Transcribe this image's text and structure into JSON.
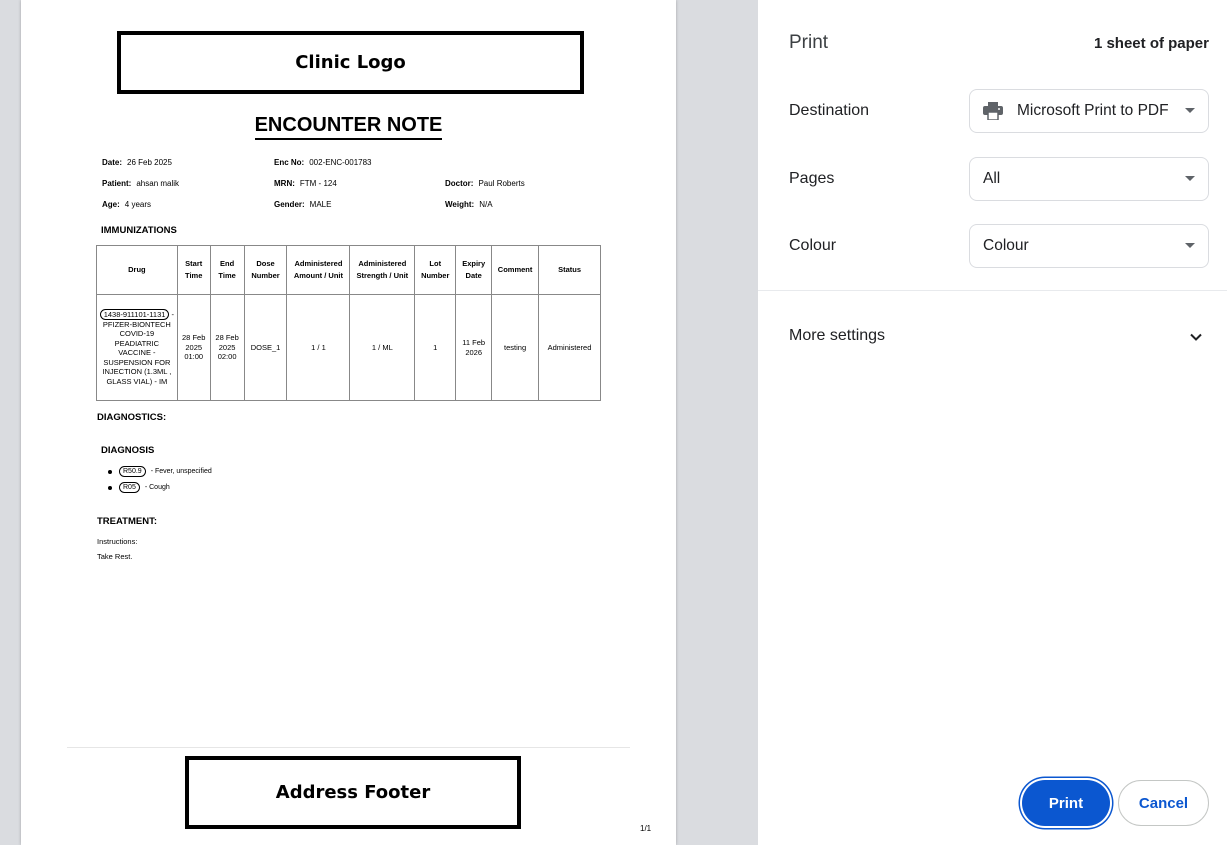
{
  "document": {
    "logo_text": "Clinic Logo",
    "title": "ENCOUNTER NOTE",
    "fields": {
      "date_label": "Date:",
      "date_value": "26 Feb 2025",
      "enc_label": "Enc No:",
      "enc_value": "002-ENC-001783",
      "patient_label": "Patient:",
      "patient_value": "ahsan malik",
      "mrn_label": "MRN:",
      "mrn_value": "FTM - 124",
      "doctor_label": "Doctor:",
      "doctor_value": "Paul Roberts",
      "age_label": "Age:",
      "age_value": "4 years",
      "gender_label": "Gender:",
      "gender_value": "MALE",
      "weight_label": "Weight:",
      "weight_value": "N/A"
    },
    "immunizations": {
      "heading": "IMMUNIZATIONS",
      "headers": [
        "Drug",
        "Start Time",
        "End Time",
        "Dose Number",
        "Administered Amount / Unit",
        "Administered Strength / Unit",
        "Lot Number",
        "Expiry Date",
        "Comment",
        "Status"
      ],
      "row": {
        "drug_code": "1438-911101-1131",
        "drug_name": " - PFIZER-BIONTECH COVID-19 PEADIATRIC VACCINE - SUSPENSION FOR INJECTION (1.3ML , GLASS VIAL) - IM",
        "start": "28 Feb 2025 01:00",
        "end": "28 Feb 2025 02:00",
        "dose": "DOSE_1",
        "amount": "1 / 1",
        "strength": "1 / ML",
        "lot": "1",
        "expiry": "11 Feb 2026",
        "comment": "testing",
        "status": "Administered"
      }
    },
    "diagnostics_heading": "DIAGNOSTICS:",
    "diagnosis_heading": "DIAGNOSIS",
    "diagnoses": [
      {
        "code": "R50.9",
        "text": "- Fever, unspecified"
      },
      {
        "code": "R05",
        "text": "- Cough"
      }
    ],
    "treatment_heading": "TREATMENT:",
    "instructions_label": "Instructions:",
    "instructions_text": "Take Rest.",
    "footer_text": "Address Footer",
    "page_number": "1/1"
  },
  "panel": {
    "title": "Print",
    "sheet_count": "1 sheet of paper",
    "destination_label": "Destination",
    "destination_value": "Microsoft Print to PDF",
    "pages_label": "Pages",
    "pages_value": "All",
    "colour_label": "Colour",
    "colour_value": "Colour",
    "more_settings": "More settings",
    "print_button": "Print",
    "cancel_button": "Cancel"
  },
  "colors": {
    "accent": "#0b57d0",
    "preview_bg": "#dadce0"
  },
  "icons": {
    "destination": "printer-icon",
    "dropdown": "caret-down-icon",
    "more_settings": "chevron-down-icon"
  }
}
